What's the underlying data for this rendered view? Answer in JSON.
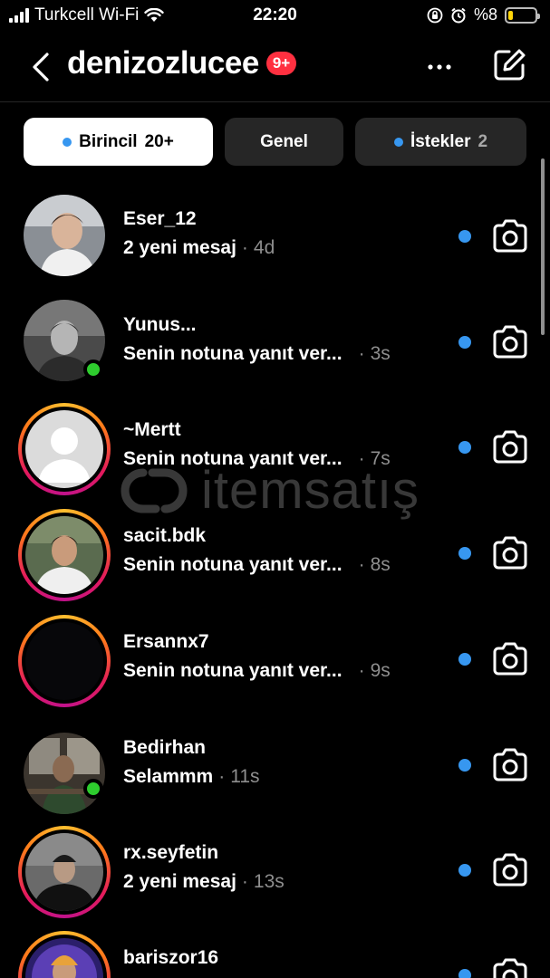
{
  "status_bar": {
    "carrier": "Turkcell Wi-Fi",
    "time": "22:20",
    "battery": "%8",
    "battery_level": 0.08
  },
  "header": {
    "title": "denizozlucee",
    "badge": "9+"
  },
  "tabs": [
    {
      "label": "Birincil",
      "count": "20+"
    },
    {
      "label": "Genel",
      "count": ""
    },
    {
      "label": "İstekler",
      "count": "2"
    }
  ],
  "conversations": [
    {
      "name": "Eser_12",
      "preview": "2 yeni mesaj",
      "time": "4d",
      "online": false,
      "story_ring": false,
      "unread": true
    },
    {
      "name": "Yunus...",
      "preview": "Senin notuna yanıt ver...",
      "time": "3s",
      "online": true,
      "story_ring": false,
      "unread": true
    },
    {
      "name": "~Mertt",
      "preview": "Senin notuna yanıt ver...",
      "time": "7s",
      "online": false,
      "story_ring": true,
      "unread": true
    },
    {
      "name": "sacit.bdk",
      "preview": "Senin notuna yanıt ver...",
      "time": "8s",
      "online": false,
      "story_ring": true,
      "unread": true
    },
    {
      "name": "Ersannx7",
      "preview": "Senin notuna yanıt ver...",
      "time": "9s",
      "online": false,
      "story_ring": true,
      "unread": true
    },
    {
      "name": "Bedirhan",
      "preview": "Selammm",
      "time": "11s",
      "online": true,
      "story_ring": false,
      "unread": true
    },
    {
      "name": "rx.seyfetin",
      "preview": "2 yeni mesaj",
      "time": "13s",
      "online": false,
      "story_ring": true,
      "unread": true
    },
    {
      "name": "bariszor16",
      "preview": "",
      "time": "",
      "online": false,
      "story_ring": true,
      "unread": true
    }
  ],
  "watermark": {
    "text": "itemsatış"
  },
  "colors": {
    "accent_blue": "#3797f0",
    "badge_red": "#ff3040",
    "online_green": "#2ecc2e",
    "battery_yellow": "#ffd60a"
  }
}
